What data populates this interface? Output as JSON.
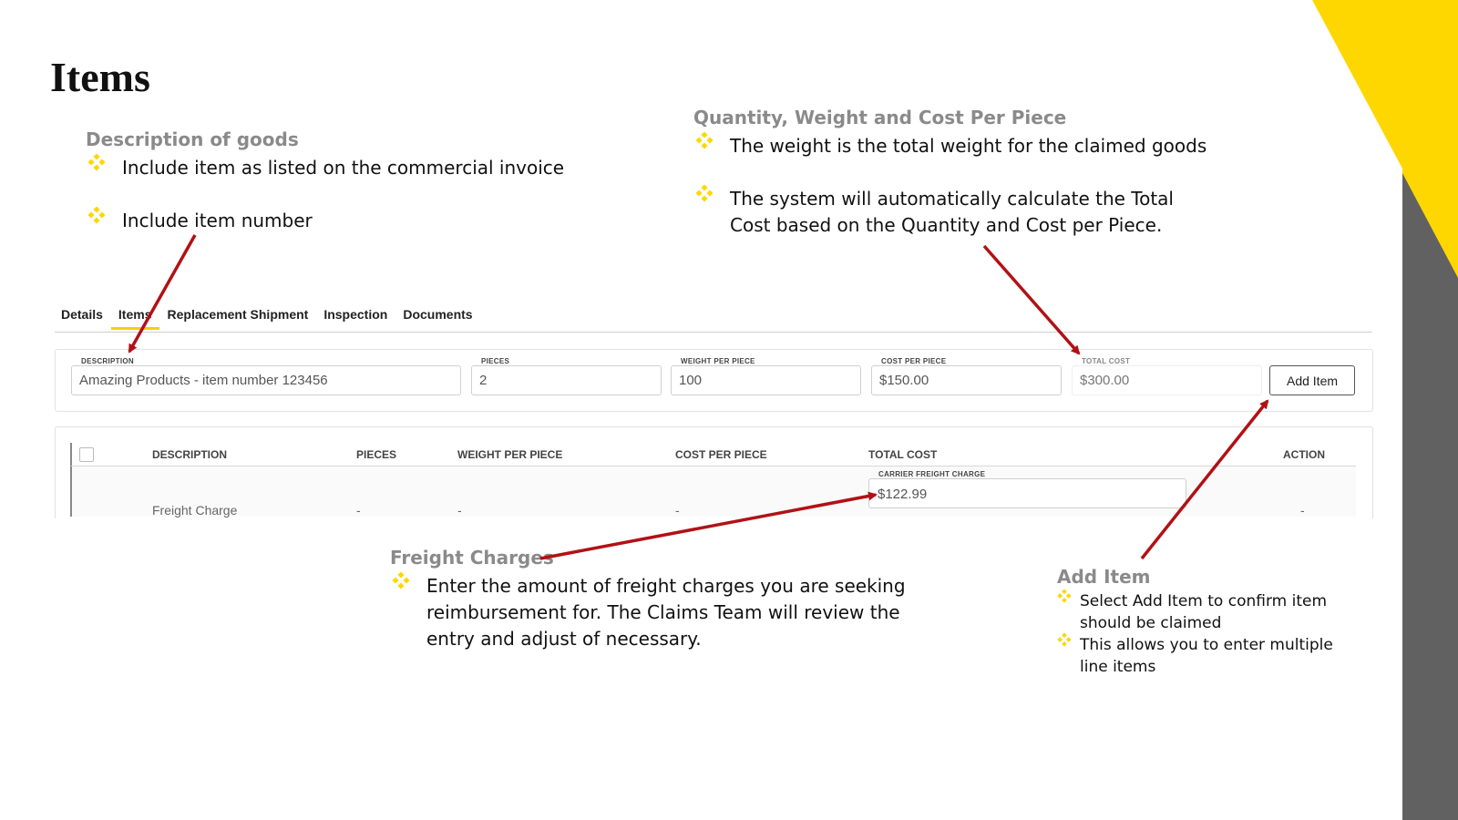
{
  "slide": {
    "title": "Items"
  },
  "colors": {
    "accent_yellow": "#FFD700",
    "side_gray": "#616161",
    "arrow_red": "#B11116",
    "heading_gray": "#8A8A8A"
  },
  "callouts": {
    "description": {
      "heading": "Description of goods",
      "bullets": [
        "Include item as listed on the commercial invoice",
        "Include item number"
      ]
    },
    "quantity": {
      "heading": "Quantity, Weight and Cost Per Piece",
      "bullets": [
        "The weight is the total weight for the claimed goods",
        "The system will automatically calculate the Total",
        "Cost based on the Quantity and Cost per Piece."
      ]
    },
    "freight": {
      "heading": "Freight Charges",
      "lines": [
        "Enter the amount of freight charges you are seeking",
        "reimbursement for. The Claims Team will review the",
        "entry and adjust of necessary."
      ]
    },
    "add_item": {
      "heading": "Add Item",
      "lines": [
        "Select Add Item to confirm item",
        "should be claimed",
        "This allows you to enter multiple",
        "line items"
      ]
    }
  },
  "tabs": [
    {
      "label": "Details",
      "active": false
    },
    {
      "label": "Items",
      "active": true
    },
    {
      "label": "Replacement Shipment",
      "active": false
    },
    {
      "label": "Inspection",
      "active": false
    },
    {
      "label": "Documents",
      "active": false
    }
  ],
  "form": {
    "description": {
      "label": "DESCRIPTION",
      "value": "Amazing Products - item number 123456"
    },
    "pieces": {
      "label": "PIECES",
      "value": "2"
    },
    "weight": {
      "label": "WEIGHT PER PIECE",
      "value": "100"
    },
    "cost": {
      "label": "COST PER PIECE",
      "value": "$150.00"
    },
    "total": {
      "label": "TOTAL COST",
      "value": "$300.00"
    },
    "add_button": "Add Item"
  },
  "table": {
    "headers": [
      "DESCRIPTION",
      "PIECES",
      "WEIGHT PER PIECE",
      "COST PER PIECE",
      "TOTAL COST",
      "ACTION"
    ],
    "row": {
      "description": "Freight Charge",
      "pieces": "-",
      "weight": "-",
      "cost": "-",
      "freight_label": "CARRIER FREIGHT CHARGE",
      "freight_value": "$122.99",
      "action": "-"
    }
  }
}
